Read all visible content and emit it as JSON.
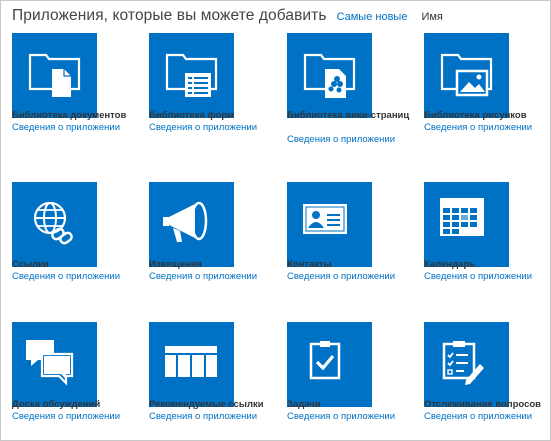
{
  "header": {
    "title": "Приложения, которые вы можете добавить",
    "sort_newest": "Самые новые",
    "sort_name": "Имя"
  },
  "accent_color": "#0072c6",
  "apps": [
    {
      "name": "Библиотека документов",
      "details": "Сведения о приложении",
      "icon": "document-library-icon"
    },
    {
      "name": "Библиотека форм",
      "details": "Сведения о приложении",
      "icon": "form-library-icon"
    },
    {
      "name": "Библиотека вики-страниц",
      "details": "Сведения о приложении",
      "icon": "wiki-library-icon"
    },
    {
      "name": "Библиотека рисунков",
      "details": "Сведения о приложении",
      "icon": "picture-library-icon"
    },
    {
      "name": "Ссылки",
      "details": "Сведения о приложении",
      "icon": "links-icon"
    },
    {
      "name": "Извещения",
      "details": "Сведения о приложении",
      "icon": "announcements-icon"
    },
    {
      "name": "Контакты",
      "details": "Сведения о приложении",
      "icon": "contacts-icon"
    },
    {
      "name": "Календарь",
      "details": "Сведения о приложении",
      "icon": "calendar-icon"
    },
    {
      "name": "Доска обсуждений",
      "details": "Сведения о приложении",
      "icon": "discussion-board-icon"
    },
    {
      "name": "Рекомендуемые ссылки",
      "details": "Сведения о приложении",
      "icon": "promoted-links-icon"
    },
    {
      "name": "Задачи",
      "details": "Сведения о приложении",
      "icon": "tasks-icon"
    },
    {
      "name": "Отслеживание вопросов",
      "details": "Сведения о приложении",
      "icon": "issue-tracking-icon"
    }
  ]
}
